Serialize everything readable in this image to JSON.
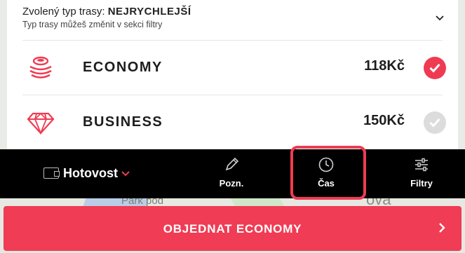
{
  "route": {
    "prefix": "Zvolený typ trasy: ",
    "type": "NEJRYCHLEJŠÍ",
    "hint": "Typ trasy můžeš změnit v sekci filtry"
  },
  "options": [
    {
      "label": "ECONOMY",
      "price": "118Kč",
      "selected": true,
      "icon": "coins-icon"
    },
    {
      "label": "BUSINESS",
      "price": "150Kč",
      "selected": false,
      "icon": "diamond-icon"
    }
  ],
  "toolbar": {
    "payment_label": "Hotovost",
    "note_label": "Pozn.",
    "time_label": "Čas",
    "filters_label": "Filtry"
  },
  "map": {
    "park_label": "Park pod",
    "partial_label": "ova"
  },
  "order": {
    "label": "OBJEDNAT ECONOMY"
  },
  "colors": {
    "accent": "#ef3b52",
    "toolbar_bg": "#000000",
    "card_bg": "#ffffff"
  }
}
